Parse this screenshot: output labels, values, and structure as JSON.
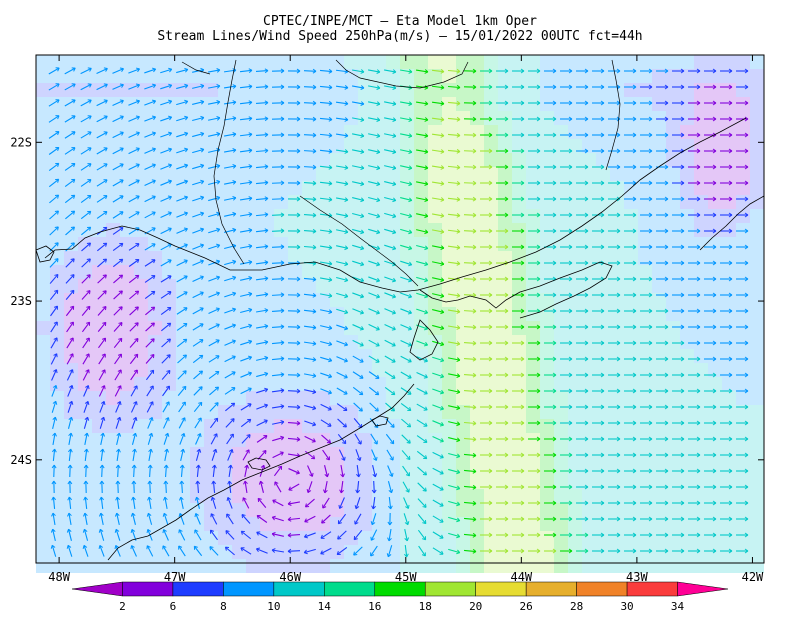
{
  "header": {
    "title_line1": "CPTEC/INPE/MCT —  Eta Model 1km Oper",
    "title_line2": "Stream Lines/Wind Speed 250hPa(m/s) — 15/01/2022 00UTC fct=44h"
  },
  "map": {
    "lon_labels": [
      "48W",
      "47W",
      "46W",
      "45W",
      "44W",
      "43W",
      "42W"
    ],
    "lat_labels": [
      "22S",
      "23S",
      "24S"
    ],
    "extent": {
      "lon": [
        -48.2,
        -41.9
      ],
      "lat": [
        -21.45,
        -24.65
      ]
    }
  },
  "colorbar": {
    "labels": [
      "2",
      "6",
      "8",
      "10",
      "14",
      "16",
      "18",
      "20",
      "26",
      "28",
      "30",
      "34"
    ],
    "colors": [
      "#a000c8",
      "#8200dc",
      "#1e3cff",
      "#0096ff",
      "#00c8c8",
      "#00dc8c",
      "#00dc00",
      "#a0e632",
      "#e6dc32",
      "#e6af2d",
      "#f08228",
      "#fa3c3c",
      "#ff0096"
    ]
  },
  "field": {
    "speed_max_m_s": 22,
    "features": [
      "anticyclonic circulation centered near 46W 24.5S",
      "jet 18-22 m/s from 44.5W to 43.5W",
      "low speed core near 47.6W 23.3S",
      "low speed core near 42.3W 21.8S"
    ]
  }
}
